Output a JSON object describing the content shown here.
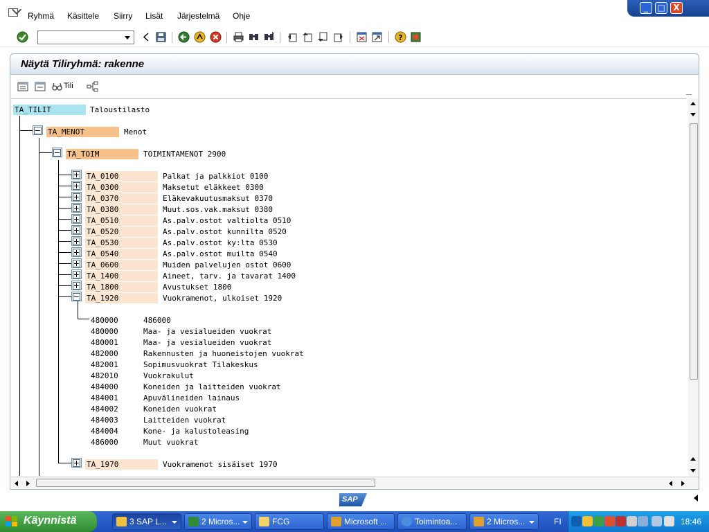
{
  "menu": {
    "items": [
      {
        "label": "Ryhmä"
      },
      {
        "label": "Käsittele"
      },
      {
        "label": "Siirry"
      },
      {
        "label": "Lisät"
      },
      {
        "label": "Järjestelmä"
      },
      {
        "label": "Ohje"
      }
    ]
  },
  "window_controls": {
    "minimize": "_",
    "maximize": "□",
    "close": "X"
  },
  "command_field": {
    "value": ""
  },
  "page": {
    "title": "Näytä Tiliryhmä: rakenne"
  },
  "app_toolbar": {
    "tili_label": "Tili"
  },
  "tree": {
    "root": {
      "key": "TA_TILIT",
      "desc": "Taloustilasto"
    },
    "level1": {
      "key": "TA_MENOT",
      "desc": "Menot"
    },
    "level2": {
      "key": "TA_TOIM",
      "desc": "TOIMINTAMENOT 2900"
    },
    "groups": [
      {
        "key": "TA_0100",
        "desc": "Palkat ja palkkiot 0100",
        "expanded": false
      },
      {
        "key": "TA_0300",
        "desc": "Maksetut eläkkeet 0300",
        "expanded": false
      },
      {
        "key": "TA_0370",
        "desc": "Eläkevakuutusmaksut 0370",
        "expanded": false
      },
      {
        "key": "TA_0380",
        "desc": "Muut.sos.vak.maksut 0380",
        "expanded": false
      },
      {
        "key": "TA_0510",
        "desc": "As.palv.ostot valtiolta 0510",
        "expanded": false
      },
      {
        "key": "TA_0520",
        "desc": "As.palv.ostot kunnilta 0520",
        "expanded": false
      },
      {
        "key": "TA_0530",
        "desc": "As.palv.ostot ky:lta 0530",
        "expanded": false
      },
      {
        "key": "TA_0540",
        "desc": "As.palv.ostot muilta 0540",
        "expanded": false
      },
      {
        "key": "TA_0600",
        "desc": "Muiden palvelujen ostot 0600",
        "expanded": false
      },
      {
        "key": "TA_1400",
        "desc": "Aineet, tarv. ja tavarat 1400",
        "expanded": false
      },
      {
        "key": "TA_1800",
        "desc": "Avustukset 1800",
        "expanded": false
      },
      {
        "key": "TA_1920",
        "desc": "Vuokramenot, ulkoiset 1920",
        "expanded": true
      }
    ],
    "range": {
      "from": "480000",
      "to": "486000"
    },
    "accounts": [
      {
        "num": "480000",
        "desc": "Maa- ja vesialueiden vuokrat"
      },
      {
        "num": "480001",
        "desc": "Maa- ja vesialueiden vuokrat"
      },
      {
        "num": "482000",
        "desc": "Rakennusten ja huoneistojen vuokrat"
      },
      {
        "num": "482001",
        "desc": "Sopimusvuokrat Tilakeskus"
      },
      {
        "num": "482010",
        "desc": "Vuokrakulut"
      },
      {
        "num": "484000",
        "desc": "Koneiden ja laitteiden vuokrat"
      },
      {
        "num": "484001",
        "desc": "Apuvälineiden lainaus"
      },
      {
        "num": "484002",
        "desc": "Koneiden vuokrat"
      },
      {
        "num": "484003",
        "desc": "Laitteiden vuokrat"
      },
      {
        "num": "484004",
        "desc": "Kone- ja kalustoleasing"
      },
      {
        "num": "486000",
        "desc": "Muut vuokrat"
      }
    ],
    "last_group": {
      "key": "TA_1970",
      "desc": "Vuokramenot sisäiset 1970"
    }
  },
  "status": {
    "logo": "SAP"
  },
  "taskbar": {
    "start": "Käynnistä",
    "tasks": [
      {
        "label": "3 SAP L..."
      },
      {
        "label": "2 Micros..."
      },
      {
        "label": "FCG"
      },
      {
        "label": "Microsoft ..."
      },
      {
        "label": "Toimintoa..."
      },
      {
        "label": "2 Micros..."
      }
    ],
    "lang": "FI",
    "clock": "18:46"
  },
  "colors": {
    "root_key_bg": "#a9e4ef",
    "branch_key_bg": "#f6c08a",
    "leaf_key_bg": "#fbe5d0",
    "title_bar": "#d8e4ef",
    "taskbar": "#2458c8",
    "start_button": "#3a9a3a"
  },
  "icons": {
    "menu": "menu-icon",
    "toolbar": [
      "enter-icon",
      "back-icon",
      "save-icon",
      "back-arrow-icon",
      "exit-icon",
      "cancel-icon",
      "print-icon",
      "find-icon",
      "find-next-icon",
      "first-page-icon",
      "prev-page-icon",
      "next-page-icon",
      "last-page-icon",
      "new-session-icon",
      "shortcut-icon",
      "help-icon",
      "customize-icon"
    ],
    "app_toolbar": [
      "expand-all-icon",
      "collapse-icon",
      "glasses-icon",
      "hierarchy-icon"
    ]
  }
}
